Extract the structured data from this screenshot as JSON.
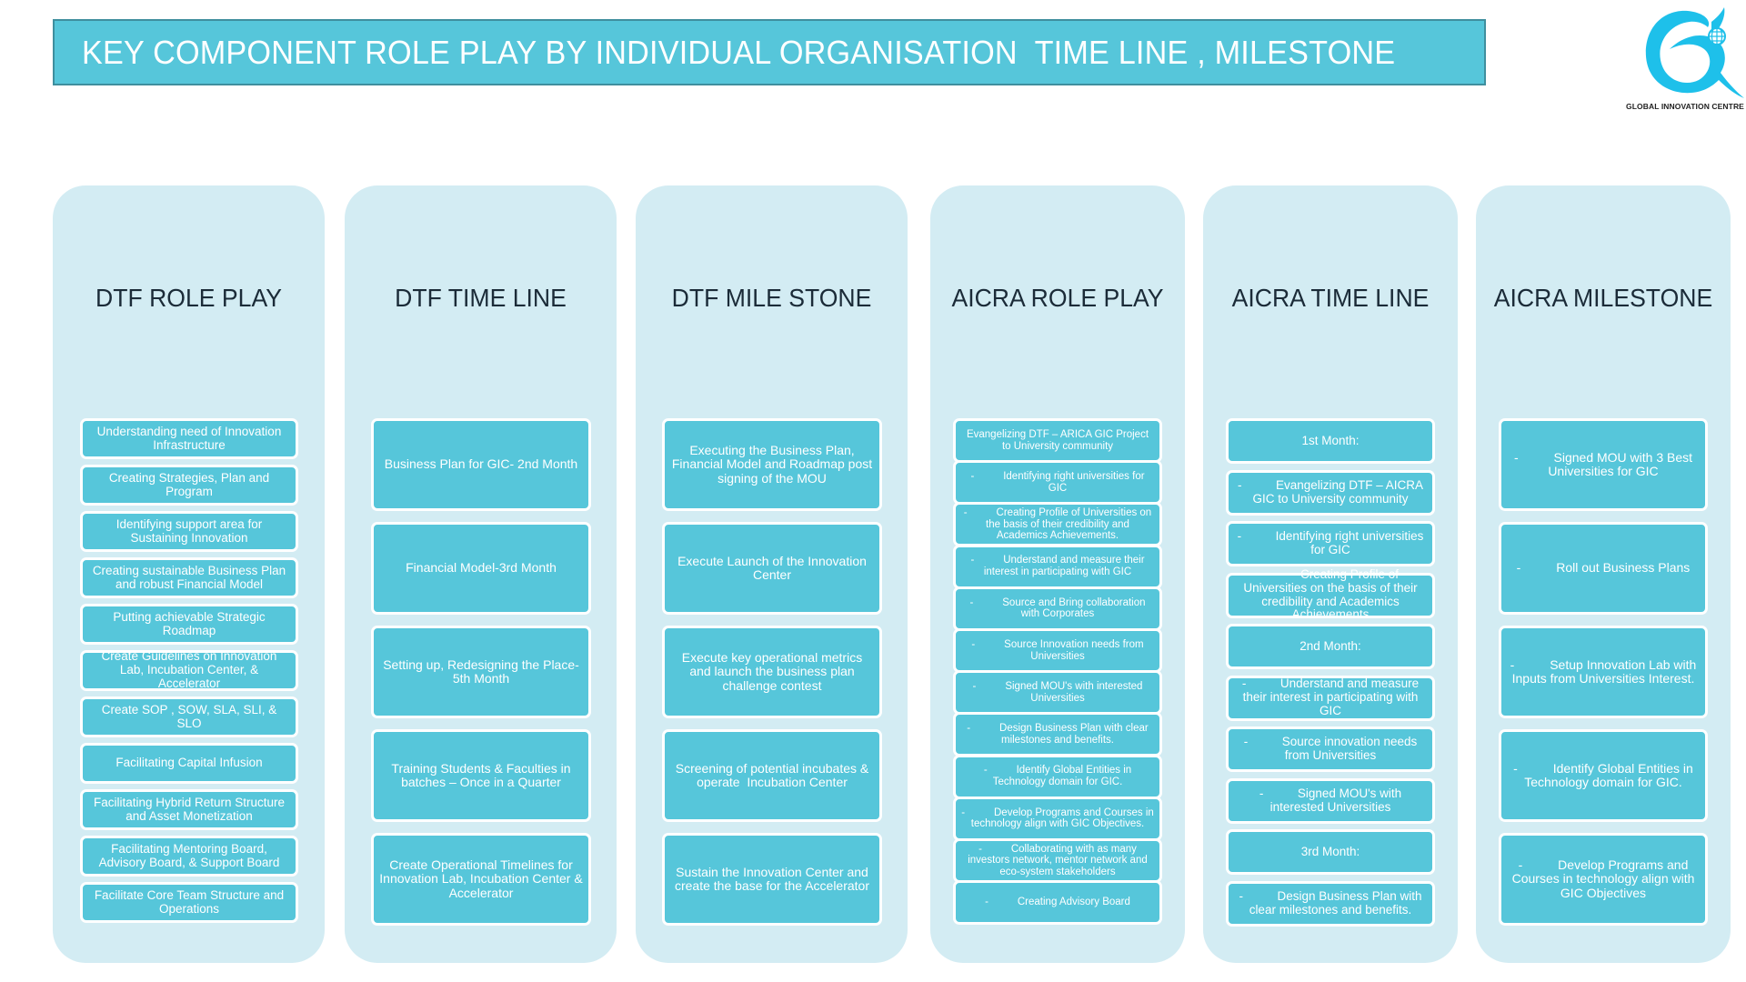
{
  "title": "KEY COMPONENT ROLE PLAY BY INDIVIDUAL ORGANISATION  TIME LINE , MILESTONE",
  "logo": {
    "icon": "global-innovation-centre-logo-icon",
    "text": "GLOBAL INNOVATION CENTRE",
    "color": "#1ec0ea"
  },
  "colors": {
    "title_bar": "#56c6da",
    "column_bg": "#d3ecf3",
    "item_bg": "#56c6da",
    "header_text": "#1b2b38"
  },
  "columns": [
    {
      "header": "DTF ROLE PLAY",
      "items": [
        "Understanding need of Innovation Infrastructure",
        "Creating Strategies, Plan and Program",
        "Identifying support area for Sustaining Innovation",
        "Creating sustainable Business Plan and robust Financial Model",
        "Putting achievable Strategic Roadmap",
        "Create Guidelines on Innovation Lab, Incubation Center, & Accelerator",
        "Create SOP , SOW, SLA, SLI, & SLO",
        "Facilitating Capital Infusion",
        "Facilitating Hybrid Return Structure and Asset Monetization",
        "Facilitating Mentoring Board, Advisory Board, & Support Board",
        "Facilitate Core Team Structure and Operations"
      ]
    },
    {
      "header": "DTF TIME LINE",
      "items": [
        "Business Plan for GIC- 2nd Month",
        "Financial Model-3rd Month",
        "Setting up, Redesigning the Place-5th Month",
        "Training Students & Faculties in batches – Once in a Quarter",
        "Create Operational Timelines for Innovation Lab, Incubation Center & Accelerator"
      ]
    },
    {
      "header": "DTF MILE STONE",
      "items": [
        "Executing the Business Plan, Financial Model and Roadmap post signing of the MOU",
        "Execute Launch of the Innovation Center",
        "Execute key operational metrics and launch the business plan challenge contest",
        "Screening of potential incubates & operate  Incubation Center",
        "Sustain the Innovation Center and create the base for the Accelerator"
      ]
    },
    {
      "header": "AICRA ROLE PLAY",
      "items": [
        "Evangelizing DTF – ARICA GIC Project to University community",
        "-          Identifying right universities for GIC",
        "-          Creating Profile of Universities on the basis of their credibility and Academics Achievements.",
        "-          Understand and measure their interest in participating with GIC",
        "-          Source and Bring collaboration with Corporates",
        "-          Source Innovation needs from Universities",
        "-          Signed MOU's with interested Universities",
        "-          Design Business Plan with clear milestones and benefits.",
        "-          Identify Global Entities in Technology domain for GIC.",
        "-          Develop Programs and Courses in technology align with GIC Objectives.",
        "-          Collaborating with as many investors network, mentor network and eco-system stakeholders",
        "-          Creating Advisory Board"
      ]
    },
    {
      "header": "AICRA TIME LINE",
      "items": [
        "1st Month:",
        "-          Evangelizing DTF – AICRA GIC to University community",
        "-          Identifying right universities for GIC",
        "-          Creating Profile of Universities on the basis of their credibility and Academics Achievements",
        "2nd Month:",
        "-          Understand and measure their interest in participating with GIC",
        "-          Source innovation needs from Universities",
        "-          Signed MOU's with interested Universities",
        "3rd Month:",
        "-          Design Business Plan with clear milestones and benefits."
      ]
    },
    {
      "header": "AICRA MILESTONE",
      "items": [
        "-          Signed MOU with 3 Best Universities for GIC",
        "-          Roll out Business Plans",
        "-          Setup Innovation Lab with Inputs from Universities Interest.",
        "-          Identify Global Entities in Technology domain for GIC.",
        "-          Develop Programs and Courses in technology align with GIC Objectives"
      ]
    }
  ]
}
